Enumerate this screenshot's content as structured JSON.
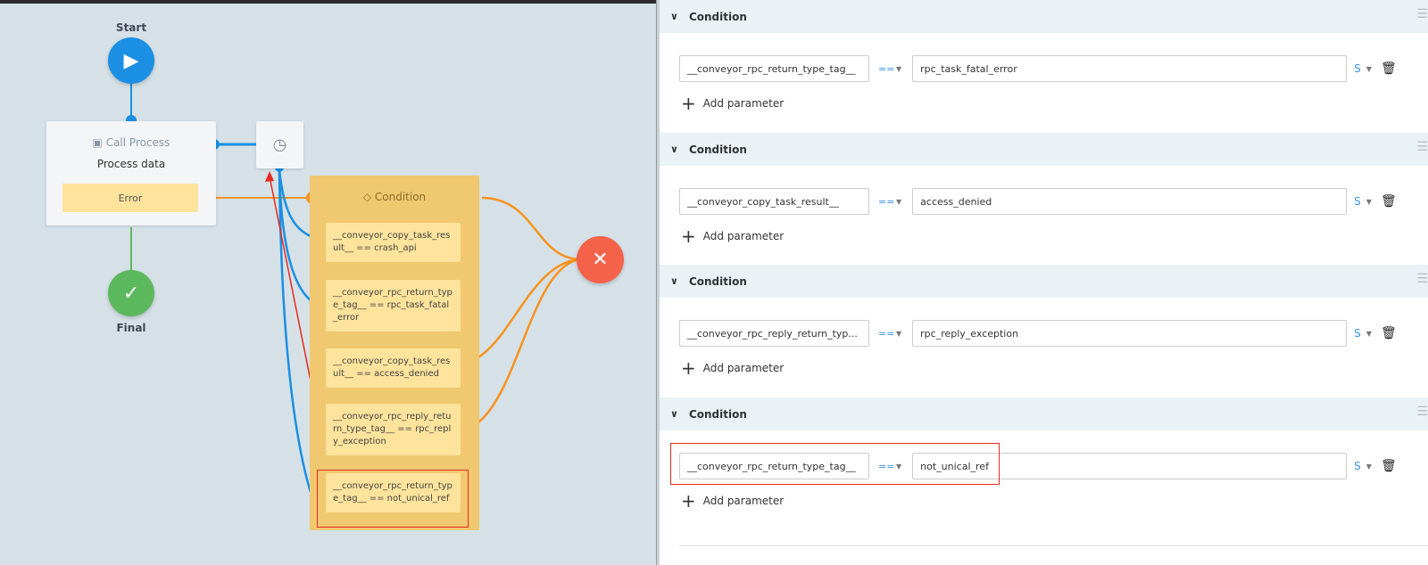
{
  "diagram": {
    "start_label": "Start",
    "final_label": "Final",
    "call_process": {
      "type": "Call Process",
      "title": "Process data",
      "error": "Error"
    },
    "condition": {
      "title": "Condition",
      "items": [
        "__conveyor_copy_task_result__ == crash_api",
        "__conveyor_rpc_return_type_tag__ == rpc_task_fatal_error",
        "__conveyor_copy_task_result__ == access_denied",
        "__conveyor_rpc_reply_return_type_tag__ == rpc_reply_exception",
        "__conveyor_rpc_return_type_tag__ == not_unical_ref"
      ]
    }
  },
  "panel": {
    "add_label": "Add parameter",
    "sections": [
      {
        "title": "Condition",
        "param": "__conveyor_rpc_return_type_tag__",
        "op": "==",
        "value": "rpc_task_fatal_error",
        "type": "S"
      },
      {
        "title": "Condition",
        "param": "__conveyor_copy_task_result__",
        "op": "==",
        "value": "access_denied",
        "type": "S"
      },
      {
        "title": "Condition",
        "param": "__conveyor_rpc_reply_return_typ...",
        "op": "==",
        "value": "rpc_reply_exception",
        "type": "S"
      },
      {
        "title": "Condition",
        "param": "__conveyor_rpc_return_type_tag__",
        "op": "==",
        "value": "not_unical_ref",
        "type": "S"
      }
    ]
  },
  "colors": {
    "blue": "#1a8fe3",
    "orange": "#f7931e",
    "red": "#f4624a",
    "green": "#5cb85c"
  }
}
